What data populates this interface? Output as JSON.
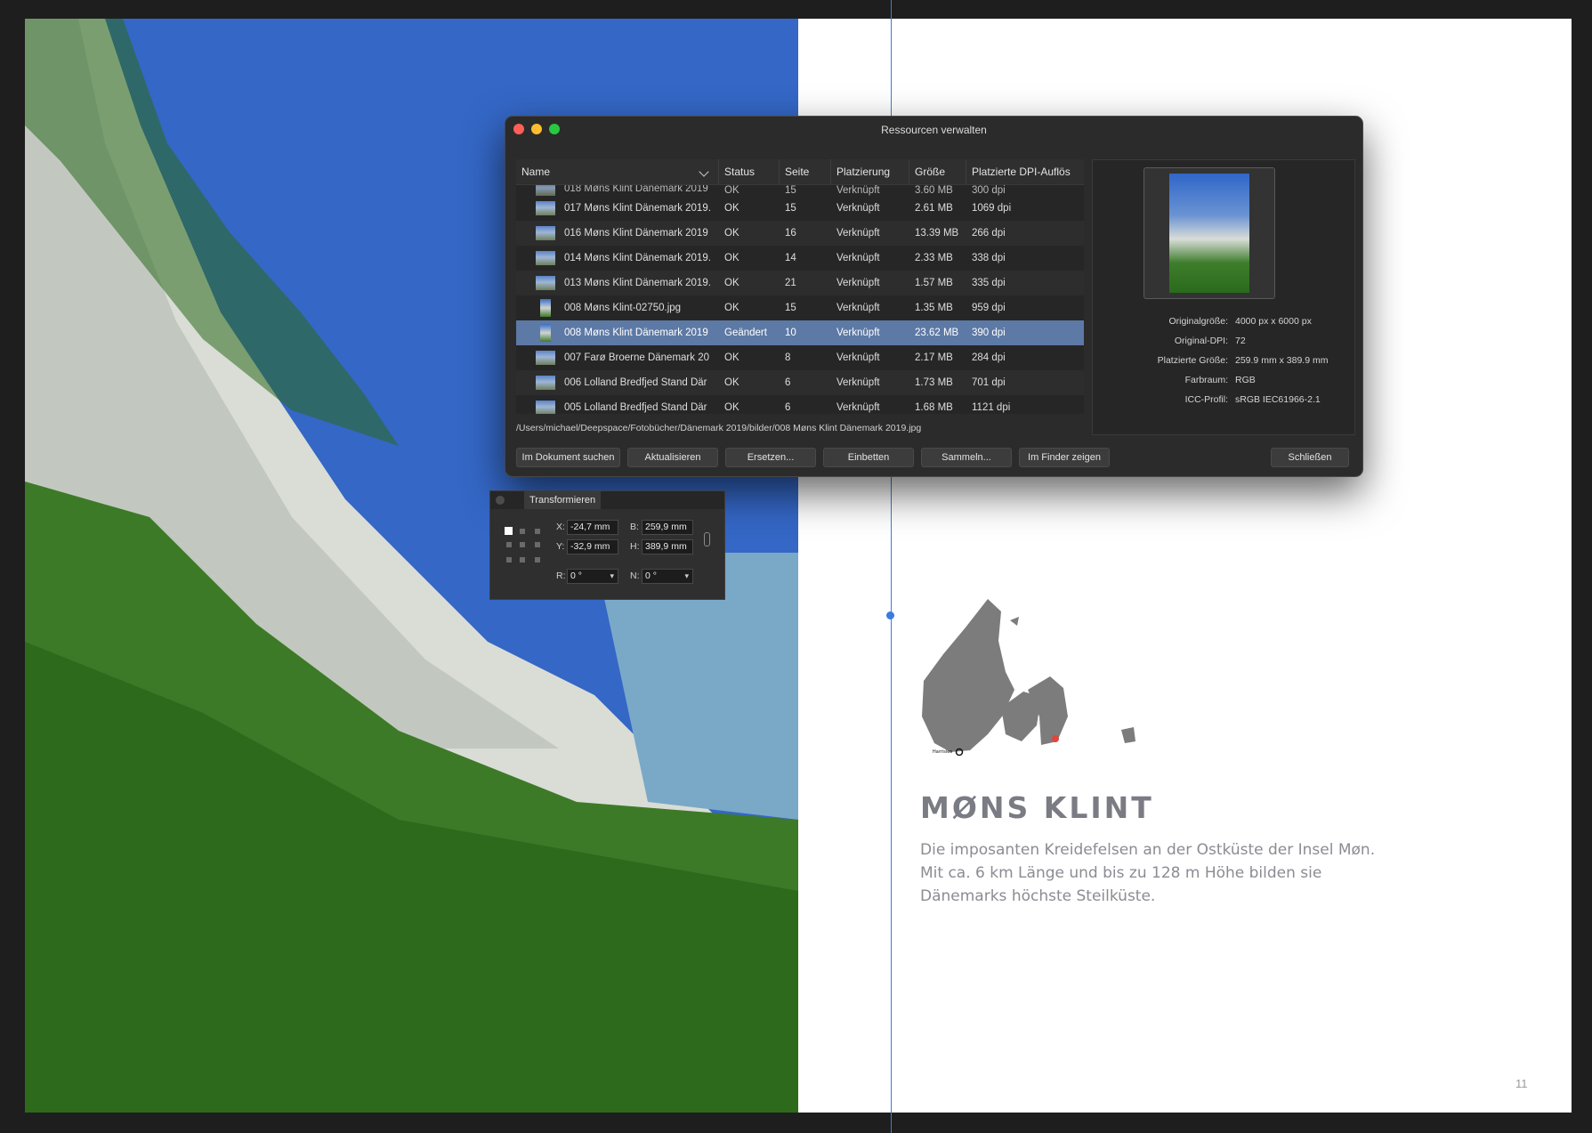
{
  "dialog": {
    "title": "Ressourcen verwalten",
    "columns": [
      "Name",
      "Status",
      "Seite",
      "Platzierung",
      "Größe",
      "Platzierte DPI-Auflös"
    ],
    "partial_row": {
      "name": "018 Møns Klint Dänemark 2019",
      "status": "OK",
      "page": "15",
      "placement": "Verknüpft",
      "size": "3.60 MB",
      "dpi": "300 dpi"
    },
    "rows": [
      {
        "name": "017 Møns Klint Dänemark 2019.",
        "status": "OK",
        "page": "15",
        "placement": "Verknüpft",
        "size": "2.61 MB",
        "dpi": "1069 dpi"
      },
      {
        "name": "016 Møns Klint Dänemark 2019",
        "status": "OK",
        "page": "16",
        "placement": "Verknüpft",
        "size": "13.39 MB",
        "dpi": "266 dpi"
      },
      {
        "name": "014 Møns Klint Dänemark 2019.",
        "status": "OK",
        "page": "14",
        "placement": "Verknüpft",
        "size": "2.33 MB",
        "dpi": "338 dpi"
      },
      {
        "name": "013 Møns Klint Dänemark 2019.",
        "status": "OK",
        "page": "21",
        "placement": "Verknüpft",
        "size": "1.57 MB",
        "dpi": "335 dpi"
      },
      {
        "name": "008 Møns Klint-02750.jpg",
        "status": "OK",
        "page": "15",
        "placement": "Verknüpft",
        "size": "1.35 MB",
        "dpi": "959 dpi"
      },
      {
        "name": "008 Møns Klint Dänemark 2019",
        "status": "Geändert",
        "page": "10",
        "placement": "Verknüpft",
        "size": "23.62 MB",
        "dpi": "390 dpi"
      },
      {
        "name": "007 Farø Broerne Dänemark 20",
        "status": "OK",
        "page": "8",
        "placement": "Verknüpft",
        "size": "2.17 MB",
        "dpi": "284 dpi"
      },
      {
        "name": "006 Lolland Bredfjed Stand Där",
        "status": "OK",
        "page": "6",
        "placement": "Verknüpft",
        "size": "1.73 MB",
        "dpi": "701 dpi"
      },
      {
        "name": "005 Lolland Bredfjed Stand Där",
        "status": "OK",
        "page": "6",
        "placement": "Verknüpft",
        "size": "1.68 MB",
        "dpi": "1121 dpi"
      }
    ],
    "path": "/Users/michael/Deepspace/Fotobücher/Dänemark 2019/bilder/008 Møns Klint Dänemark 2019.jpg",
    "info": [
      {
        "label": "Originalgröße:",
        "value": "4000 px x 6000 px"
      },
      {
        "label": "Original-DPI:",
        "value": "72"
      },
      {
        "label": "Platzierte Größe:",
        "value": "259.9 mm x 389.9 mm"
      },
      {
        "label": "Farbraum:",
        "value": "RGB"
      },
      {
        "label": "ICC-Profil:",
        "value": "sRGB IEC61966-2.1"
      }
    ],
    "buttons": {
      "find": "Im Dokument suchen",
      "update": "Aktualisieren",
      "replace": "Ersetzen...",
      "embed": "Einbetten",
      "collect": "Sammeln...",
      "finder": "Im Finder zeigen",
      "close": "Schließen"
    }
  },
  "transform": {
    "tab": "Transformieren",
    "x_label": "X:",
    "x": "-24,7 mm",
    "y_label": "Y:",
    "y": "-32,9 mm",
    "w_label": "B:",
    "w": "259,9 mm",
    "h_label": "H:",
    "h": "389,9 mm",
    "r_label": "R:",
    "r": "0 °",
    "s_label": "N:",
    "s": "0 °"
  },
  "page": {
    "heading": "Møns Klint",
    "text": "Die imposanten Kreidefelsen an der Ostküste der Insel Møn. Mit ca. 6 km Länge und bis zu 128 m Höhe bilden sie Dänemarks höchste Steilküste.",
    "number": "11",
    "map_label": "Harrislee"
  },
  "colors": {
    "selection": "#5d79a5",
    "guide": "#3d7be0",
    "pin": "#e0463c"
  }
}
